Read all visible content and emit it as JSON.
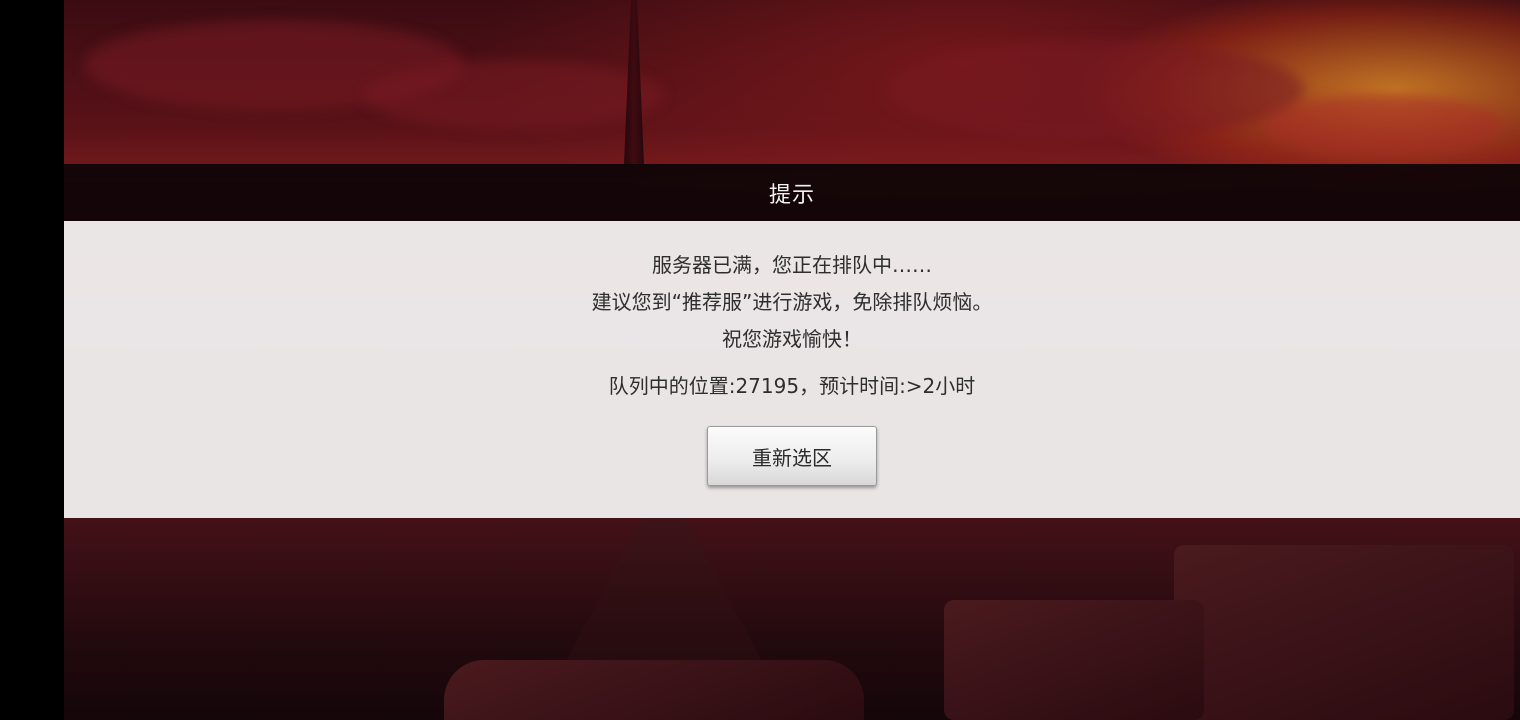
{
  "dialog": {
    "title": "提示",
    "message_lines": [
      "服务器已满，您正在排队中……",
      "建议您到“推荐服”进行游戏，免除排队烦恼。",
      "祝您游戏愉快！"
    ],
    "queue_status": "队列中的位置:27195，预计时间:>2小时",
    "reselect_button_label": "重新选区"
  },
  "colors": {
    "title_bar_bg": "#0c0406",
    "panel_bg": "#f0eeee",
    "text": "#2e2e2e",
    "background_sky": "#5a1218",
    "sunset_glow": "#e69628"
  }
}
